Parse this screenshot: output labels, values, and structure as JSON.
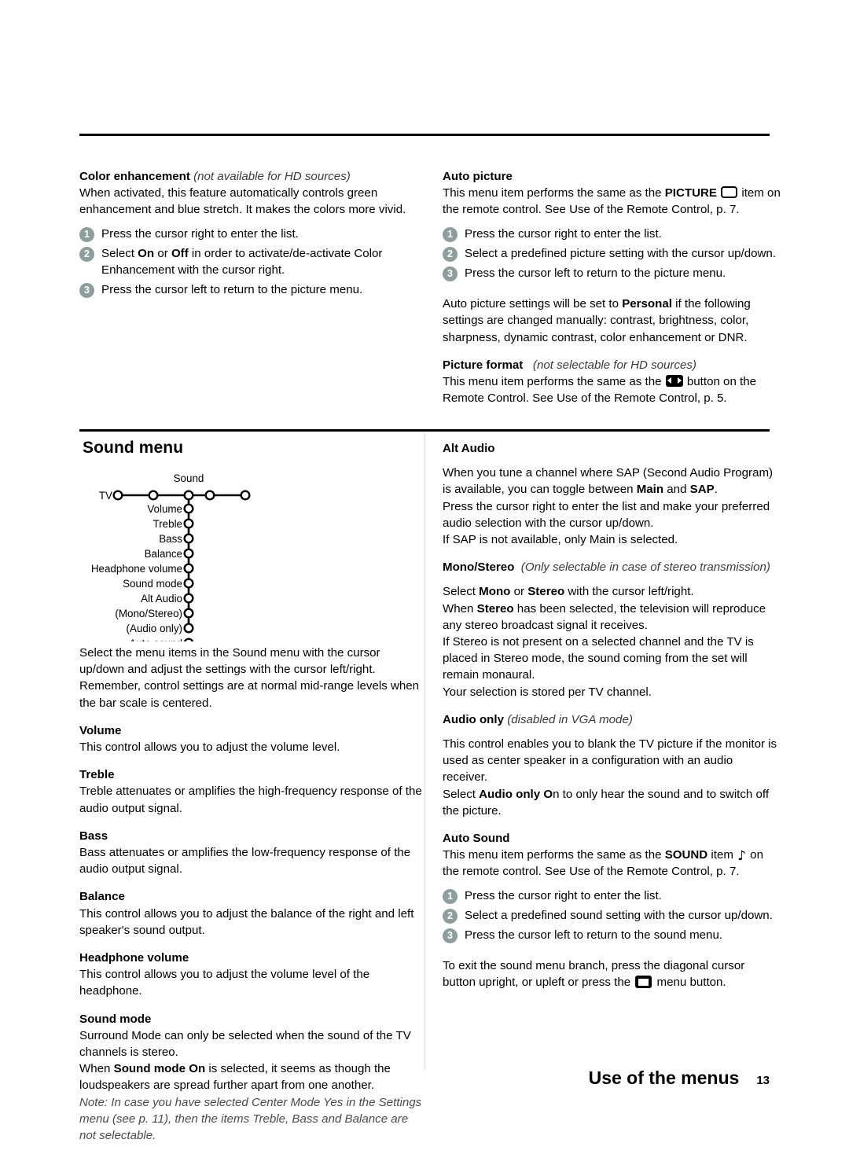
{
  "page": {
    "footer_title": "Use of the menus",
    "footer_page": "13"
  },
  "left_column_top": {
    "heading": "Color enhancement",
    "heading_note": "(not available for HD sources)",
    "body": "When activated, this feature automatically controls green enhancement and blue stretch. It makes the colors more vivid.",
    "steps": [
      {
        "num": "1",
        "text": "Press the cursor right to enter the list."
      },
      {
        "num": "2",
        "text_pre": "Select ",
        "bold1": "On",
        "text_mid": " or ",
        "bold2": "Off",
        "text_post": " in order to activate/de-activate Color Enhancement with the cursor right."
      },
      {
        "num": "3",
        "text": "Press the cursor left to return to the picture menu."
      }
    ]
  },
  "right_column_top": {
    "heading": "Auto picture",
    "body_pre": "This menu item performs the same as the ",
    "body_bold": "PICTURE",
    "icon": "tv-screen-icon",
    "body_post": " item on the remote control. See Use of the Remote Control, p. 7.",
    "steps": [
      {
        "num": "1",
        "text": "Press the cursor right to enter the list."
      },
      {
        "num": "2",
        "text": "Select a predefined picture setting with the cursor up/down."
      },
      {
        "num": "3",
        "text": "Press the cursor left to return to the picture menu."
      }
    ],
    "personal_note_pre": "Auto picture settings will be set to ",
    "personal_note_bold": "Personal",
    "personal_note_post": " if the following settings are changed manually: contrast, brightness, color, sharpness, dynamic contrast, color enhancement or DNR.",
    "picture_format_heading": "Picture format",
    "picture_format_note": "(not selectable for HD sources)",
    "picture_format_pre": "This menu item performs the same as the ",
    "picture_format_icon": "picture-format-icon",
    "picture_format_post": " button on the Remote Control. See Use of the Remote Control, p. 5."
  },
  "sound_section": {
    "title": "Sound menu",
    "diagram": {
      "root_label": "Sound",
      "tv_label": "TV",
      "horizontal_nodes": 5,
      "branch_items": [
        "Volume",
        "Treble",
        "Bass",
        "Balance",
        "Headphone volume",
        "Sound mode",
        "Alt Audio",
        "(Mono/Stereo)",
        "(Audio only)",
        "Auto sound"
      ]
    },
    "intro": "Select the menu items in the Sound menu with the cursor up/down and adjust the settings with the cursor left/right. Remember, control settings are at normal mid-range levels when the bar scale is centered.",
    "items": [
      {
        "heading": "Volume",
        "body": "This control allows you to adjust the volume level."
      },
      {
        "heading": "Treble",
        "body": "Treble attenuates or amplifies the high-frequency response of the audio output signal."
      },
      {
        "heading": "Bass",
        "body": "Bass attenuates or amplifies the low-frequency response of the audio output signal."
      },
      {
        "heading": "Balance",
        "body": "This control allows you to adjust the balance of the right and left speaker's sound output."
      },
      {
        "heading": "Headphone volume",
        "body": "This control allows you to adjust the volume level of the headphone."
      }
    ],
    "sound_mode": {
      "heading": "Sound mode",
      "line1": "Surround Mode can only be selected when the sound of the TV channels is stereo.",
      "line2_pre": "When ",
      "line2_bold": "Sound mode On",
      "line2_post": " is selected, it seems as though the loudspeakers are spread further apart from one another.",
      "note": "Note: In case you have selected Center Mode Yes in the Settings menu (see p. 11), then the items Treble, Bass and Balance are not selectable."
    }
  },
  "right_column_sound": {
    "alt_audio": {
      "heading": "Alt Audio",
      "line1_pre": "When you tune a channel where SAP (Second Audio Program) is available, you can toggle between ",
      "line1_bold1": "Main",
      "line1_mid": " and ",
      "line1_bold2": "SAP",
      "line1_post": ".",
      "line2": "Press the cursor right to enter the list and make your preferred audio selection with the cursor up/down.",
      "line3": "If SAP is not available, only Main is selected."
    },
    "mono_stereo": {
      "heading": "Mono/Stereo",
      "heading_note": "(Only selectable in case of stereo transmission)",
      "line1_pre": "Select ",
      "line1_bold1": "Mono",
      "line1_mid": " or ",
      "line1_bold2": "Stereo",
      "line1_post": " with the cursor left/right.",
      "line2_pre": "When ",
      "line2_bold": "Stereo",
      "line2_post": " has been selected, the television will reproduce any stereo broadcast signal it receives.",
      "line3": "If Stereo is not present on a selected channel and the TV is placed in Stereo mode, the sound coming from the set will remain monaural.",
      "line4": "Your selection is stored per TV channel."
    },
    "audio_only": {
      "heading": "Audio only",
      "heading_note": "(disabled in VGA mode)",
      "line1": "This control enables you to blank the TV picture if the monitor is used as center speaker in a configuration with an audio receiver.",
      "line2_pre": "Select ",
      "line2_bold": "Audio only O",
      "line2_post": "n to only hear the sound and to switch off the picture."
    },
    "auto_sound": {
      "heading": "Auto Sound",
      "body_pre": "This menu item performs the same as the ",
      "body_bold": "SOUND",
      "body_mid": " item ",
      "icon": "music-note-icon",
      "body_post": " on the remote control. See Use of the Remote Control, p. 7.",
      "steps": [
        {
          "num": "1",
          "text": "Press the cursor right to enter the list."
        },
        {
          "num": "2",
          "text": "Select a predefined sound setting with the cursor up/down."
        },
        {
          "num": "3",
          "text": "Press the cursor left to return to the sound menu."
        }
      ],
      "exit_pre": "To exit the sound menu branch, press the diagonal cursor button upright, or upleft or press the ",
      "exit_icon": "menu-button-icon",
      "exit_post": " menu button."
    }
  }
}
